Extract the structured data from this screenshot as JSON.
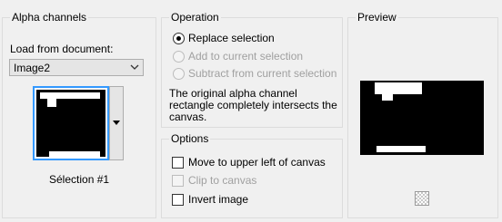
{
  "alpha": {
    "title": "Alpha channels",
    "load_label": "Load from document:",
    "document": "Image2",
    "selection_name": "Sélection #1"
  },
  "operation": {
    "title": "Operation",
    "options": [
      {
        "label": "Replace selection",
        "selected": true,
        "enabled": true
      },
      {
        "label": "Add to current selection",
        "selected": false,
        "enabled": false
      },
      {
        "label": "Subtract from current selection",
        "selected": false,
        "enabled": false
      }
    ],
    "message_line1": "The original alpha channel",
    "message_line2": "rectangle completely intersects the",
    "message_line3": "canvas."
  },
  "options": {
    "title": "Options",
    "items": [
      {
        "label": "Move to upper left of canvas",
        "checked": false,
        "enabled": true
      },
      {
        "label": "Clip to canvas",
        "checked": false,
        "enabled": false
      },
      {
        "label": "Invert image",
        "checked": false,
        "enabled": true
      }
    ]
  },
  "preview": {
    "title": "Preview"
  },
  "icons": {
    "combo_arrow": "chevron-down-icon",
    "thumb_dropdown": "caret-down-icon",
    "preview_toggle": "checkerboard-icon"
  },
  "colors": {
    "selection_border": "#3399ff",
    "disabled_text": "#a0a0a0"
  }
}
